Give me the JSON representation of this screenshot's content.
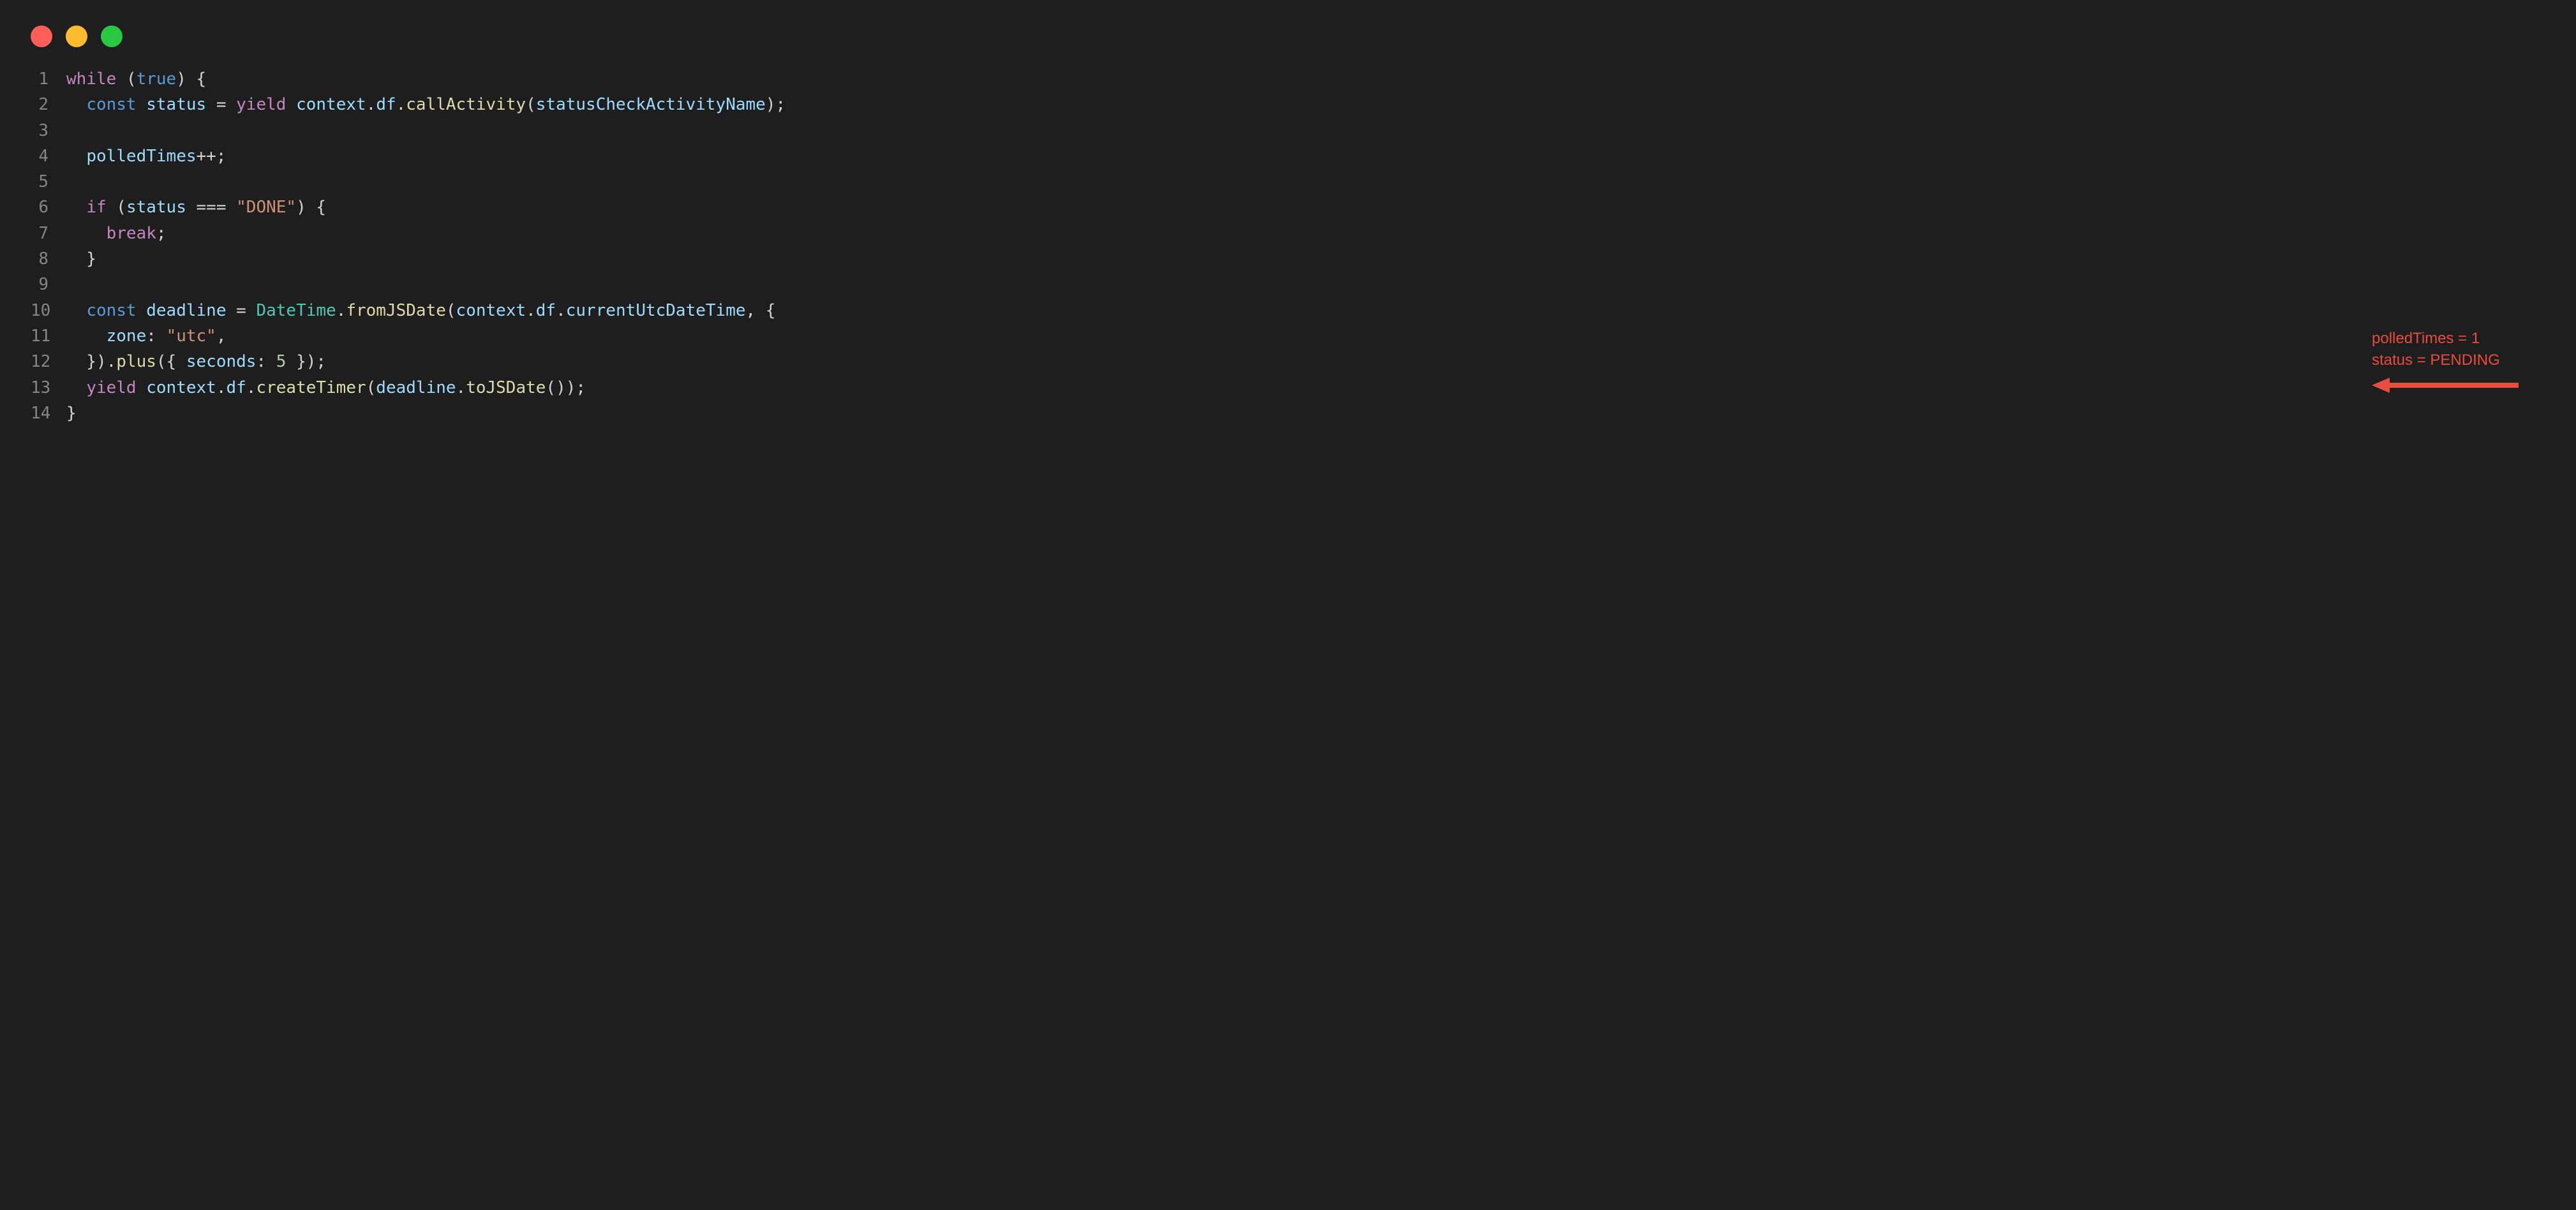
{
  "window": {
    "traffic_lights": [
      "close",
      "minimize",
      "zoom"
    ]
  },
  "code": {
    "lines": [
      {
        "num": "1",
        "tokens": [
          {
            "t": "while",
            "c": "kw"
          },
          {
            "t": " ",
            "c": "pun"
          },
          {
            "t": "(",
            "c": "pun"
          },
          {
            "t": "true",
            "c": "bool"
          },
          {
            "t": ")",
            "c": "pun"
          },
          {
            "t": " {",
            "c": "pun"
          }
        ]
      },
      {
        "num": "2",
        "tokens": [
          {
            "t": "  ",
            "c": "pun"
          },
          {
            "t": "const",
            "c": "kw2"
          },
          {
            "t": " ",
            "c": "pun"
          },
          {
            "t": "status",
            "c": "var"
          },
          {
            "t": " = ",
            "c": "pun"
          },
          {
            "t": "yield",
            "c": "kw"
          },
          {
            "t": " ",
            "c": "pun"
          },
          {
            "t": "context",
            "c": "var"
          },
          {
            "t": ".",
            "c": "pun"
          },
          {
            "t": "df",
            "c": "prop"
          },
          {
            "t": ".",
            "c": "pun"
          },
          {
            "t": "callActivity",
            "c": "func"
          },
          {
            "t": "(",
            "c": "pun"
          },
          {
            "t": "statusCheckActivityName",
            "c": "var"
          },
          {
            "t": ");",
            "c": "pun"
          }
        ]
      },
      {
        "num": "3",
        "tokens": []
      },
      {
        "num": "4",
        "tokens": [
          {
            "t": "  ",
            "c": "pun"
          },
          {
            "t": "polledTimes",
            "c": "var"
          },
          {
            "t": "++;",
            "c": "pun"
          }
        ]
      },
      {
        "num": "5",
        "tokens": []
      },
      {
        "num": "6",
        "tokens": [
          {
            "t": "  ",
            "c": "pun"
          },
          {
            "t": "if",
            "c": "kw"
          },
          {
            "t": " (",
            "c": "pun"
          },
          {
            "t": "status",
            "c": "var"
          },
          {
            "t": " === ",
            "c": "pun"
          },
          {
            "t": "\"DONE\"",
            "c": "str"
          },
          {
            "t": ") {",
            "c": "pun"
          }
        ]
      },
      {
        "num": "7",
        "tokens": [
          {
            "t": "    ",
            "c": "pun"
          },
          {
            "t": "break",
            "c": "kw"
          },
          {
            "t": ";",
            "c": "pun"
          }
        ]
      },
      {
        "num": "8",
        "tokens": [
          {
            "t": "  }",
            "c": "pun"
          }
        ]
      },
      {
        "num": "9",
        "tokens": []
      },
      {
        "num": "10",
        "tokens": [
          {
            "t": "  ",
            "c": "pun"
          },
          {
            "t": "const",
            "c": "kw2"
          },
          {
            "t": " ",
            "c": "pun"
          },
          {
            "t": "deadline",
            "c": "var"
          },
          {
            "t": " = ",
            "c": "pun"
          },
          {
            "t": "DateTime",
            "c": "type"
          },
          {
            "t": ".",
            "c": "pun"
          },
          {
            "t": "fromJSDate",
            "c": "func"
          },
          {
            "t": "(",
            "c": "pun"
          },
          {
            "t": "context",
            "c": "var"
          },
          {
            "t": ".",
            "c": "pun"
          },
          {
            "t": "df",
            "c": "prop"
          },
          {
            "t": ".",
            "c": "pun"
          },
          {
            "t": "currentUtcDateTime",
            "c": "prop"
          },
          {
            "t": ", {",
            "c": "pun"
          }
        ]
      },
      {
        "num": "11",
        "tokens": [
          {
            "t": "    ",
            "c": "pun"
          },
          {
            "t": "zone",
            "c": "prop"
          },
          {
            "t": ": ",
            "c": "pun"
          },
          {
            "t": "\"utc\"",
            "c": "str"
          },
          {
            "t": ",",
            "c": "pun"
          }
        ]
      },
      {
        "num": "12",
        "tokens": [
          {
            "t": "  }).",
            "c": "pun"
          },
          {
            "t": "plus",
            "c": "func"
          },
          {
            "t": "({ ",
            "c": "pun"
          },
          {
            "t": "seconds",
            "c": "prop"
          },
          {
            "t": ": ",
            "c": "pun"
          },
          {
            "t": "5",
            "c": "num"
          },
          {
            "t": " });",
            "c": "pun"
          }
        ]
      },
      {
        "num": "13",
        "tokens": [
          {
            "t": "  ",
            "c": "pun"
          },
          {
            "t": "yield",
            "c": "kw"
          },
          {
            "t": " ",
            "c": "pun"
          },
          {
            "t": "context",
            "c": "var"
          },
          {
            "t": ".",
            "c": "pun"
          },
          {
            "t": "df",
            "c": "prop"
          },
          {
            "t": ".",
            "c": "pun"
          },
          {
            "t": "createTimer",
            "c": "func"
          },
          {
            "t": "(",
            "c": "pun"
          },
          {
            "t": "deadline",
            "c": "var"
          },
          {
            "t": ".",
            "c": "pun"
          },
          {
            "t": "toJSDate",
            "c": "func"
          },
          {
            "t": "());",
            "c": "pun"
          }
        ]
      },
      {
        "num": "14",
        "tokens": [
          {
            "t": "}",
            "c": "pun"
          }
        ]
      }
    ]
  },
  "annotation": {
    "line1": "polledTimes = 1",
    "line2": "status = PENDING",
    "arrow_color": "#e84c3d",
    "points_to_line": 13
  }
}
